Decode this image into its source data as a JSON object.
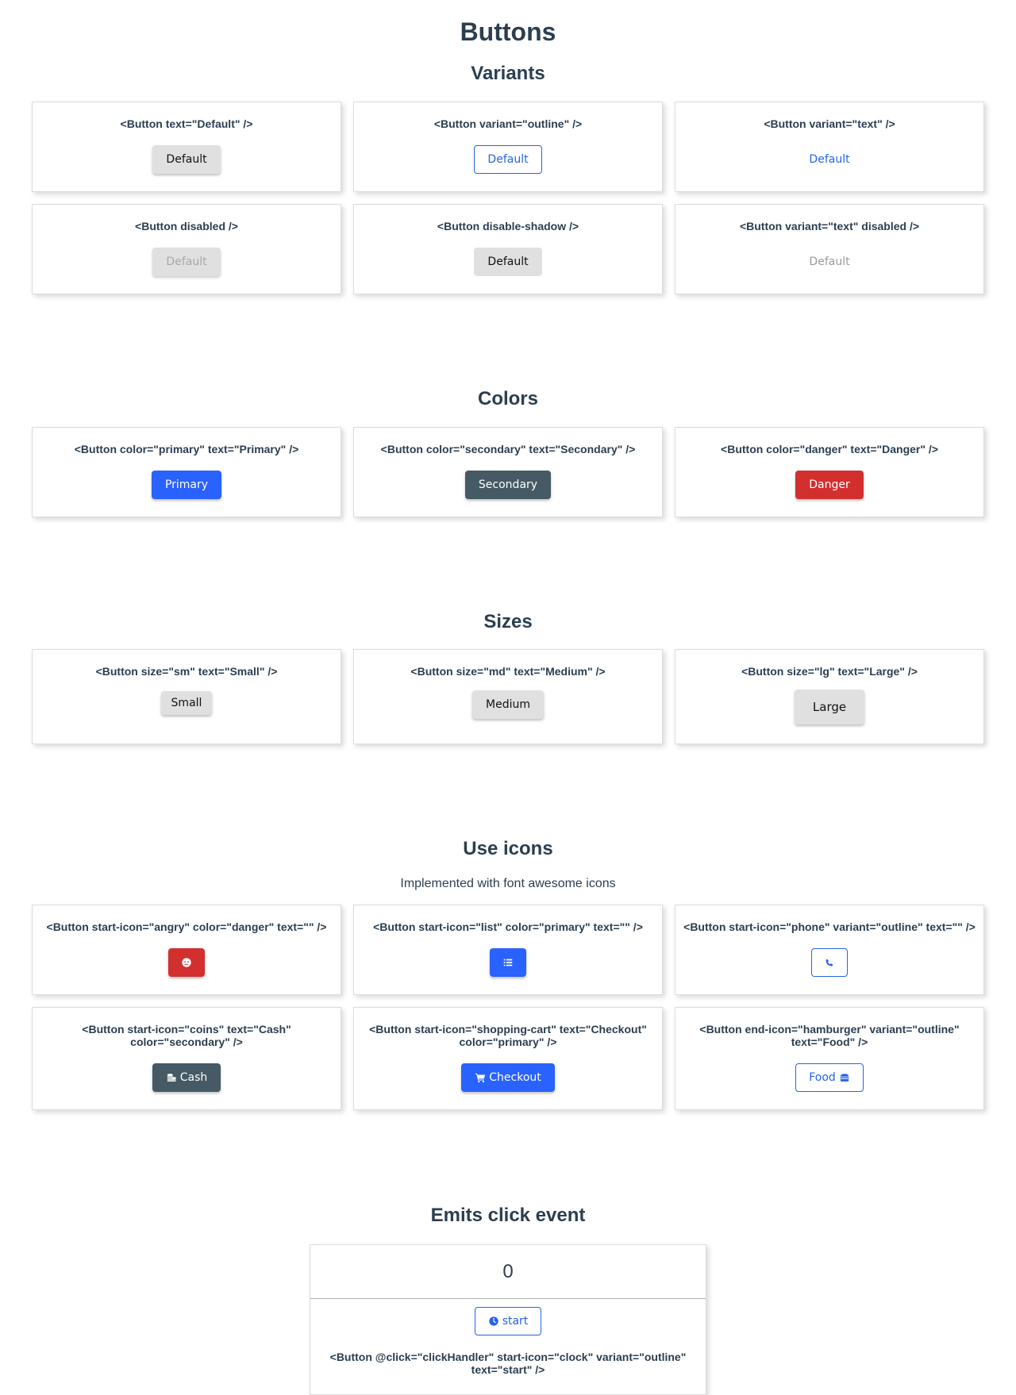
{
  "page": {
    "title": "Buttons"
  },
  "sections": {
    "variants": {
      "title": "Variants",
      "cards": [
        {
          "code": "<Button text=\"Default\" />",
          "label": "Default"
        },
        {
          "code": "<Button variant=\"outline\" />",
          "label": "Default"
        },
        {
          "code": "<Button variant=\"text\" />",
          "label": "Default"
        },
        {
          "code": "<Button disabled />",
          "label": "Default"
        },
        {
          "code": "<Button disable-shadow />",
          "label": "Default"
        },
        {
          "code": "<Button variant=\"text\" disabled />",
          "label": "Default"
        }
      ]
    },
    "colors": {
      "title": "Colors",
      "cards": [
        {
          "code": "<Button color=\"primary\" text=\"Primary\" />",
          "label": "Primary",
          "color": "#2962ff"
        },
        {
          "code": "<Button color=\"secondary\" text=\"Secondary\" />",
          "label": "Secondary",
          "color": "#455a64"
        },
        {
          "code": "<Button color=\"danger\" text=\"Danger\" />",
          "label": "Danger",
          "color": "#d32f2f"
        }
      ]
    },
    "sizes": {
      "title": "Sizes",
      "cards": [
        {
          "code": "<Button size=\"sm\" text=\"Small\" />",
          "label": "Small"
        },
        {
          "code": "<Button size=\"md\" text=\"Medium\" />",
          "label": "Medium"
        },
        {
          "code": "<Button size=\"lg\" text=\"Large\" />",
          "label": "Large"
        }
      ]
    },
    "icons": {
      "title": "Use icons",
      "subtitle": "Implemented with font awesome icons",
      "cards": [
        {
          "code": "<Button start-icon=\"angry\" color=\"danger\" text=\"\" />",
          "icon": "angry-icon",
          "label": ""
        },
        {
          "code": "<Button start-icon=\"list\" color=\"primary\" text=\"\" />",
          "icon": "list-icon",
          "label": ""
        },
        {
          "code": "<Button start-icon=\"phone\" variant=\"outline\" text=\"\" />",
          "icon": "phone-icon",
          "label": ""
        },
        {
          "code": "<Button start-icon=\"coins\" text=\"Cash\" color=\"secondary\" />",
          "icon": "coins-icon",
          "label": "Cash"
        },
        {
          "code": "<Button start-icon=\"shopping-cart\" text=\"Checkout\" color=\"primary\" />",
          "icon": "shopping-cart-icon",
          "label": "Checkout"
        },
        {
          "code": "<Button end-icon=\"hamburger\" variant=\"outline\" text=\"Food\" />",
          "icon": "hamburger-icon",
          "label": "Food"
        }
      ]
    },
    "click": {
      "title": "Emits click event",
      "count": "0",
      "label": "start",
      "icon": "clock-icon",
      "code": "<Button @click=\"clickHandler\" start-icon=\"clock\" variant=\"outline\" text=\"start\" />"
    }
  },
  "colors": {
    "primary": "#2962ff",
    "secondary": "#455a64",
    "danger": "#d32f2f",
    "outline": "#2563eb",
    "default_bg": "#e0e0e0",
    "text": "#2c3e50"
  }
}
